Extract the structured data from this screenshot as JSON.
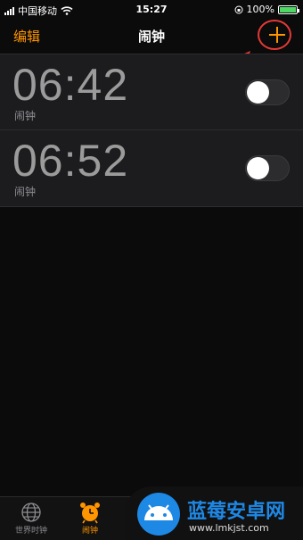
{
  "status_bar": {
    "carrier": "中国移动",
    "time": "15:27",
    "battery": "100%",
    "battery_level": 1.0
  },
  "nav": {
    "edit_label": "编辑",
    "title": "闹钟",
    "add_icon": "plus-icon"
  },
  "alarms": [
    {
      "time": "06:42",
      "label": "闹钟",
      "enabled": false
    },
    {
      "time": "06:52",
      "label": "闹钟",
      "enabled": false
    }
  ],
  "tabs": [
    {
      "label": "世界时钟",
      "icon": "globe-icon",
      "active": false
    },
    {
      "label": "闹钟",
      "icon": "alarm-clock-icon",
      "active": true
    }
  ],
  "watermark": {
    "title": "蓝莓安卓网",
    "url": "www.lmkjst.com"
  },
  "colors": {
    "accent": "#ff9500",
    "highlight": "#e53935",
    "battery": "#4cd964",
    "watermark": "#1e88e5"
  }
}
